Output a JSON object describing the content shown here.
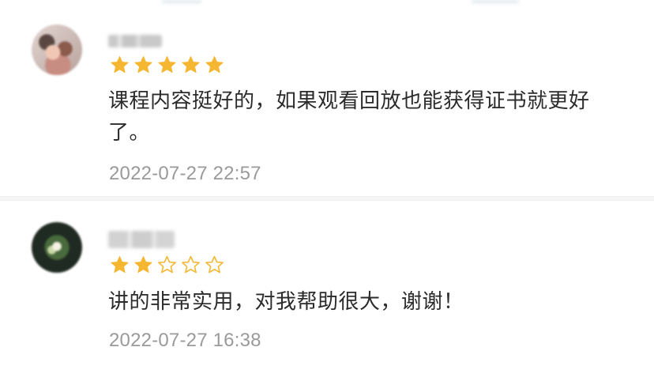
{
  "colors": {
    "star_filled": "#f5b731",
    "star_empty": "#f5b731",
    "comment_text": "#2b2b2b",
    "timestamp_text": "#9a9a9a",
    "divider": "#f6f6f6"
  },
  "comments": [
    {
      "avatar_icon": "blurred-user-avatar",
      "username": "",
      "rating": 5,
      "rating_max": 5,
      "text": "课程内容挺好的，如果观看回放也能获得证书就更好了。",
      "time": "2022-07-27 22:57"
    },
    {
      "avatar_icon": "blurred-user-avatar",
      "username": "",
      "rating": 2,
      "rating_max": 5,
      "text": "讲的非常实用，对我帮助很大，谢谢！",
      "time": "2022-07-27 16:38"
    }
  ]
}
